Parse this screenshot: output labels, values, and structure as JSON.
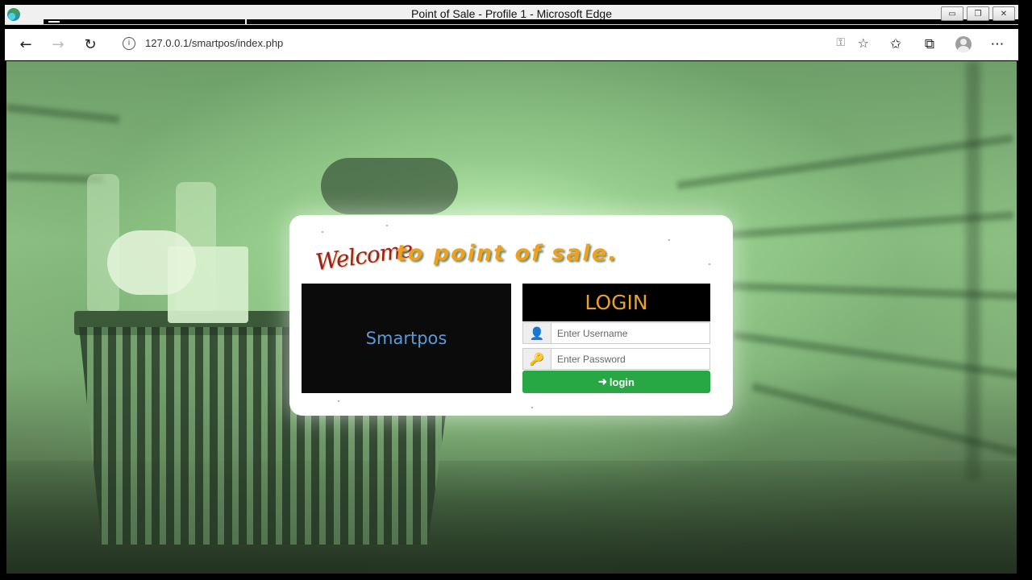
{
  "window": {
    "title": "Point of Sale - Profile 1 - Microsoft Edge",
    "minimize_icon": "minimize-icon",
    "maximize_icon": "restore-icon",
    "close_icon": "close-icon"
  },
  "browser": {
    "url": "127.0.0.1/smartpos/index.php",
    "back_icon": "←",
    "forward_icon": "→",
    "refresh_icon": "↻",
    "info_icon": "i",
    "key_icon": "⚿",
    "favorite_add_icon": "☆",
    "favorites_icon": "✩",
    "collections_icon": "⧉",
    "more_icon": "⋯"
  },
  "login_card": {
    "welcome": "Welcome",
    "tagline": "to point of sale.",
    "brand": "Smartpos",
    "heading": "LOGIN",
    "username_placeholder": "Enter Username",
    "password_placeholder": "Enter Password",
    "login_button": "login",
    "user_icon": "👤",
    "password_icon": "🔑",
    "login_icon": "➜"
  },
  "colors": {
    "accent_orange": "#e8a030",
    "button_green": "#28a745",
    "brand_blue": "#5b9bd5",
    "welcome_red": "#9b2020"
  }
}
